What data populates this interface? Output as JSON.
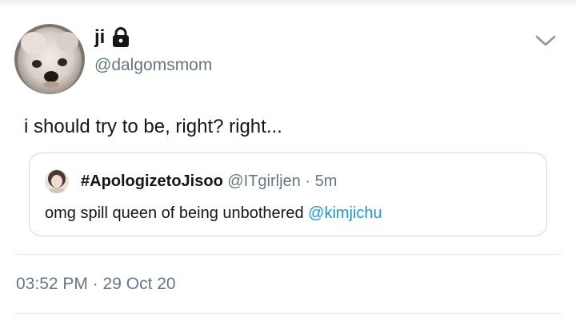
{
  "author": {
    "display_name": "ji",
    "handle": "@dalgomsmom"
  },
  "tweet": {
    "text": "i should try to be, right? right..."
  },
  "quoted": {
    "display_name": "#ApologizetoJisoo",
    "handle": "@ITgirljen",
    "separator": "·",
    "age": "5m",
    "text": "omg spill queen of being unbothered",
    "mention": "@kimjichu"
  },
  "meta": {
    "timestamp": "03:52 PM · 29 Oct 20"
  },
  "icons": {
    "lock": "lock-icon",
    "more": "chevron-down-icon"
  },
  "colors": {
    "text": "#14171a",
    "secondary": "#657786",
    "link": "#1b95e0",
    "border": "#ccd6dd"
  }
}
